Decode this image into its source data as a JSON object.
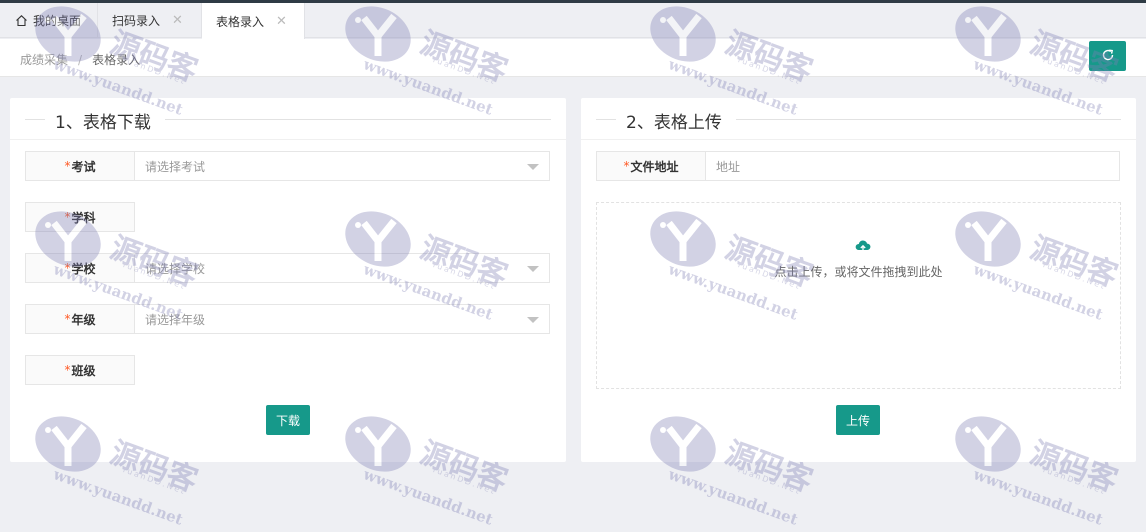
{
  "tabs": [
    {
      "label": "我的桌面",
      "icon": "home-icon",
      "active": false,
      "closable": false
    },
    {
      "label": "扫码录入",
      "active": false,
      "closable": true
    },
    {
      "label": "表格录入",
      "active": true,
      "closable": true
    }
  ],
  "tab_close_glyph": "✕",
  "breadcrumb": {
    "parent": "成绩采集",
    "separator": "/",
    "current": "表格录入"
  },
  "refresh_icon": "refresh-icon",
  "download_card": {
    "title": "1、表格下载",
    "fields": [
      {
        "label": "考试",
        "type": "select",
        "placeholder": "请选择考试"
      },
      {
        "label": "学科",
        "type": "empty"
      },
      {
        "label": "学校",
        "type": "select",
        "placeholder": "请选择学校"
      },
      {
        "label": "年级",
        "type": "select",
        "placeholder": "请选择年级"
      },
      {
        "label": "班级",
        "type": "empty"
      }
    ],
    "required_mark": "*",
    "button_label": "下载"
  },
  "upload_card": {
    "title": "2、表格上传",
    "address_label": "文件地址",
    "address_placeholder": "地址",
    "required_mark": "*",
    "drop_text": "点击上传，或将文件拖拽到此处",
    "button_label": "上传"
  },
  "watermark": {
    "cn": "源码客",
    "url": "www.yuandd.net",
    "sub": "YuanDD.Net"
  },
  "colors": {
    "accent": "#16998a",
    "required": "#ff5722",
    "watermark": "#7f7fb5"
  }
}
